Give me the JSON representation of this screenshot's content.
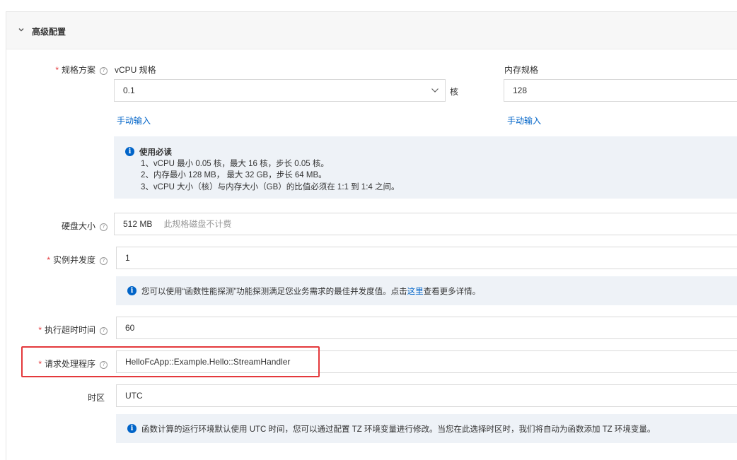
{
  "section": {
    "title": "高级配置",
    "icon": "chevron-down-icon"
  },
  "spec": {
    "label": "规格方案",
    "required": "*",
    "help": "?",
    "vcpu": {
      "label": "vCPU 规格",
      "value": "0.1",
      "unit": "核",
      "manual_link": "手动输入"
    },
    "memory": {
      "label": "内存规格",
      "value": "128",
      "manual_link": "手动输入"
    },
    "notice": {
      "title": "使用必读",
      "lines": [
        "1、vCPU 最小 0.05 核，最大 16 核，步长 0.05 核。",
        "2、内存最小 128 MB， 最大 32 GB，步长 64 MB。",
        "3、vCPU 大小（核）与内存大小（GB）的比值必须在 1:1 到 1:4 之间。"
      ]
    }
  },
  "disk": {
    "label": "硬盘大小",
    "help": "?",
    "value": "512 MB",
    "hint": "此规格磁盘不计费"
  },
  "concurrency": {
    "label": "实例并发度",
    "required": "*",
    "help": "?",
    "value": "1",
    "notice_prefix": "您可以使用“函数性能探测”功能探测满足您业务需求的最佳并发度值。点击",
    "notice_link": "这里",
    "notice_suffix": "查看更多详情。"
  },
  "timeout": {
    "label": "执行超时时间",
    "required": "*",
    "help": "?",
    "value": "60"
  },
  "handler": {
    "label": "请求处理程序",
    "required": "*",
    "help": "?",
    "value": "HelloFcApp::Example.Hello::StreamHandler"
  },
  "timezone": {
    "label": "时区",
    "value": "UTC",
    "notice": "函数计算的运行环境默认使用 UTC 时间，您可以通过配置 TZ 环境变量进行修改。当您在此选择时区时，我们将自动为函数添加 TZ 环境变量。"
  },
  "colors": {
    "accent": "#0064c8",
    "required": "#e4393c",
    "highlight": "#e4393c",
    "notice_bg": "#eef2f7"
  }
}
